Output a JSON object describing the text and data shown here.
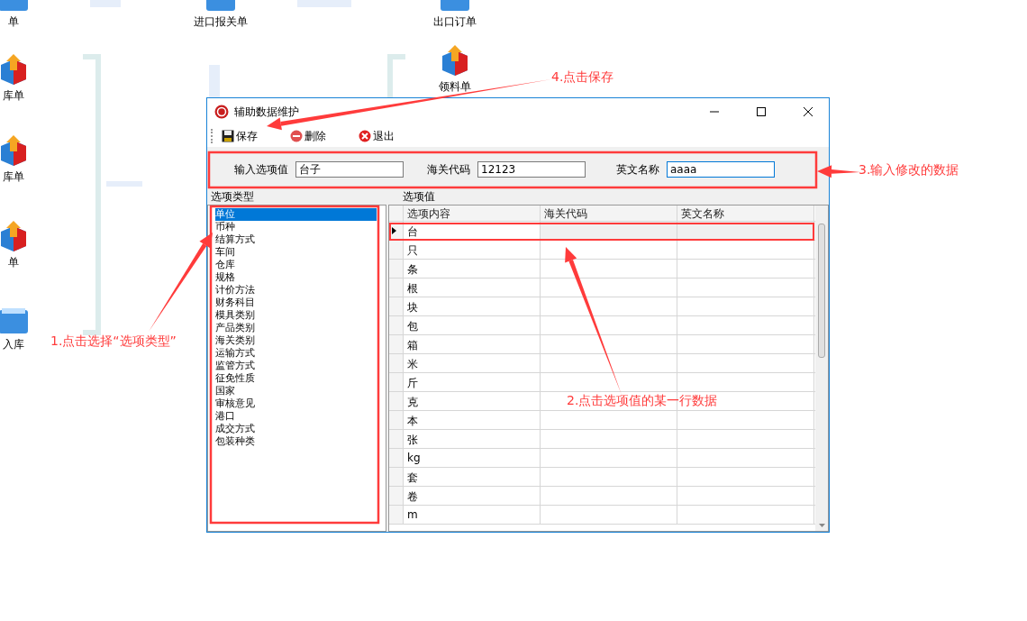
{
  "desktop_icons": [
    {
      "label": "单",
      "kind": "doc"
    },
    {
      "label": "进口报关单",
      "kind": "doc"
    },
    {
      "label": "出口订单",
      "kind": "doc"
    },
    {
      "label": "领料单",
      "kind": "box"
    },
    {
      "label": "库单",
      "kind": "box"
    },
    {
      "label": "库单",
      "kind": "box"
    },
    {
      "label": "单",
      "kind": "box"
    },
    {
      "label": "入库",
      "kind": "doc"
    }
  ],
  "window": {
    "title": "辅助数据维护",
    "toolbar": [
      {
        "label": "保存",
        "kind": "save"
      },
      {
        "label": "删除",
        "kind": "delete"
      },
      {
        "label": "退出",
        "kind": "exit"
      }
    ],
    "form": [
      {
        "label": "输入选项值",
        "value": "台子",
        "focused": false
      },
      {
        "label": "海关代码",
        "value": "12123",
        "focused": false
      },
      {
        "label": "英文名称",
        "value": "aaaa",
        "focused": true
      }
    ],
    "option_types": {
      "label": "选项类型",
      "items": [
        {
          "label": "单位",
          "selected": true
        },
        {
          "label": "币种",
          "selected": false
        },
        {
          "label": "结算方式",
          "selected": false
        },
        {
          "label": "车间",
          "selected": false
        },
        {
          "label": "仓库",
          "selected": false
        },
        {
          "label": "规格",
          "selected": false
        },
        {
          "label": "计价方法",
          "selected": false
        },
        {
          "label": "财务科目",
          "selected": false
        },
        {
          "label": "模具类别",
          "selected": false
        },
        {
          "label": "产品类别",
          "selected": false
        },
        {
          "label": "海关类别",
          "selected": false
        },
        {
          "label": "运输方式",
          "selected": false
        },
        {
          "label": "监管方式",
          "selected": false
        },
        {
          "label": "征免性质",
          "selected": false
        },
        {
          "label": "国家",
          "selected": false
        },
        {
          "label": "审核意见",
          "selected": false
        },
        {
          "label": "港口",
          "selected": false
        },
        {
          "label": "成交方式",
          "selected": false
        },
        {
          "label": "包装种类",
          "selected": false
        }
      ]
    },
    "option_values": {
      "label": "选项值",
      "columns": [
        "选项内容",
        "海关代码",
        "英文名称"
      ],
      "rows": [
        {
          "content": "台",
          "selected": true
        },
        {
          "content": "只",
          "selected": false
        },
        {
          "content": "条",
          "selected": false
        },
        {
          "content": "根",
          "selected": false
        },
        {
          "content": "块",
          "selected": false
        },
        {
          "content": "包",
          "selected": false
        },
        {
          "content": "箱",
          "selected": false
        },
        {
          "content": "米",
          "selected": false
        },
        {
          "content": "斤",
          "selected": false
        },
        {
          "content": "克",
          "selected": false
        },
        {
          "content": "本",
          "selected": false
        },
        {
          "content": "张",
          "selected": false
        },
        {
          "content": "kg",
          "selected": false
        },
        {
          "content": "套",
          "selected": false
        },
        {
          "content": "卷",
          "selected": false
        },
        {
          "content": "m",
          "selected": false
        }
      ]
    }
  },
  "annotations": [
    {
      "text": "4.点击保存"
    },
    {
      "text": "3.输入修改的数据"
    },
    {
      "text": "2.点击选项值的某一行数据"
    },
    {
      "text": "1.点击选择“选项类型”"
    }
  ]
}
